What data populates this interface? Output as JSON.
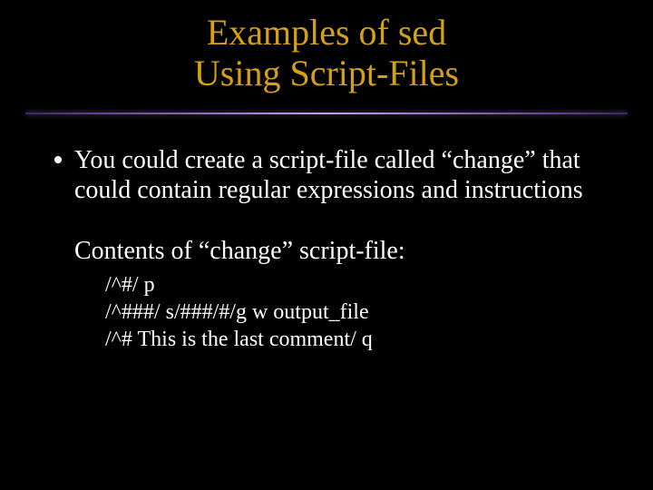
{
  "title": {
    "line1": "Examples of sed",
    "line2": "Using Script-Files"
  },
  "bullet1": "You could create a script-file called “change” that could contain regular expressions and instructions",
  "contents_label": "Contents of “change” script-file:",
  "script": {
    "l1": "/^#/ p",
    "l2": "/^###/ s/###/#/g w output_file",
    "l3": "/^# This is the last comment/ q"
  }
}
